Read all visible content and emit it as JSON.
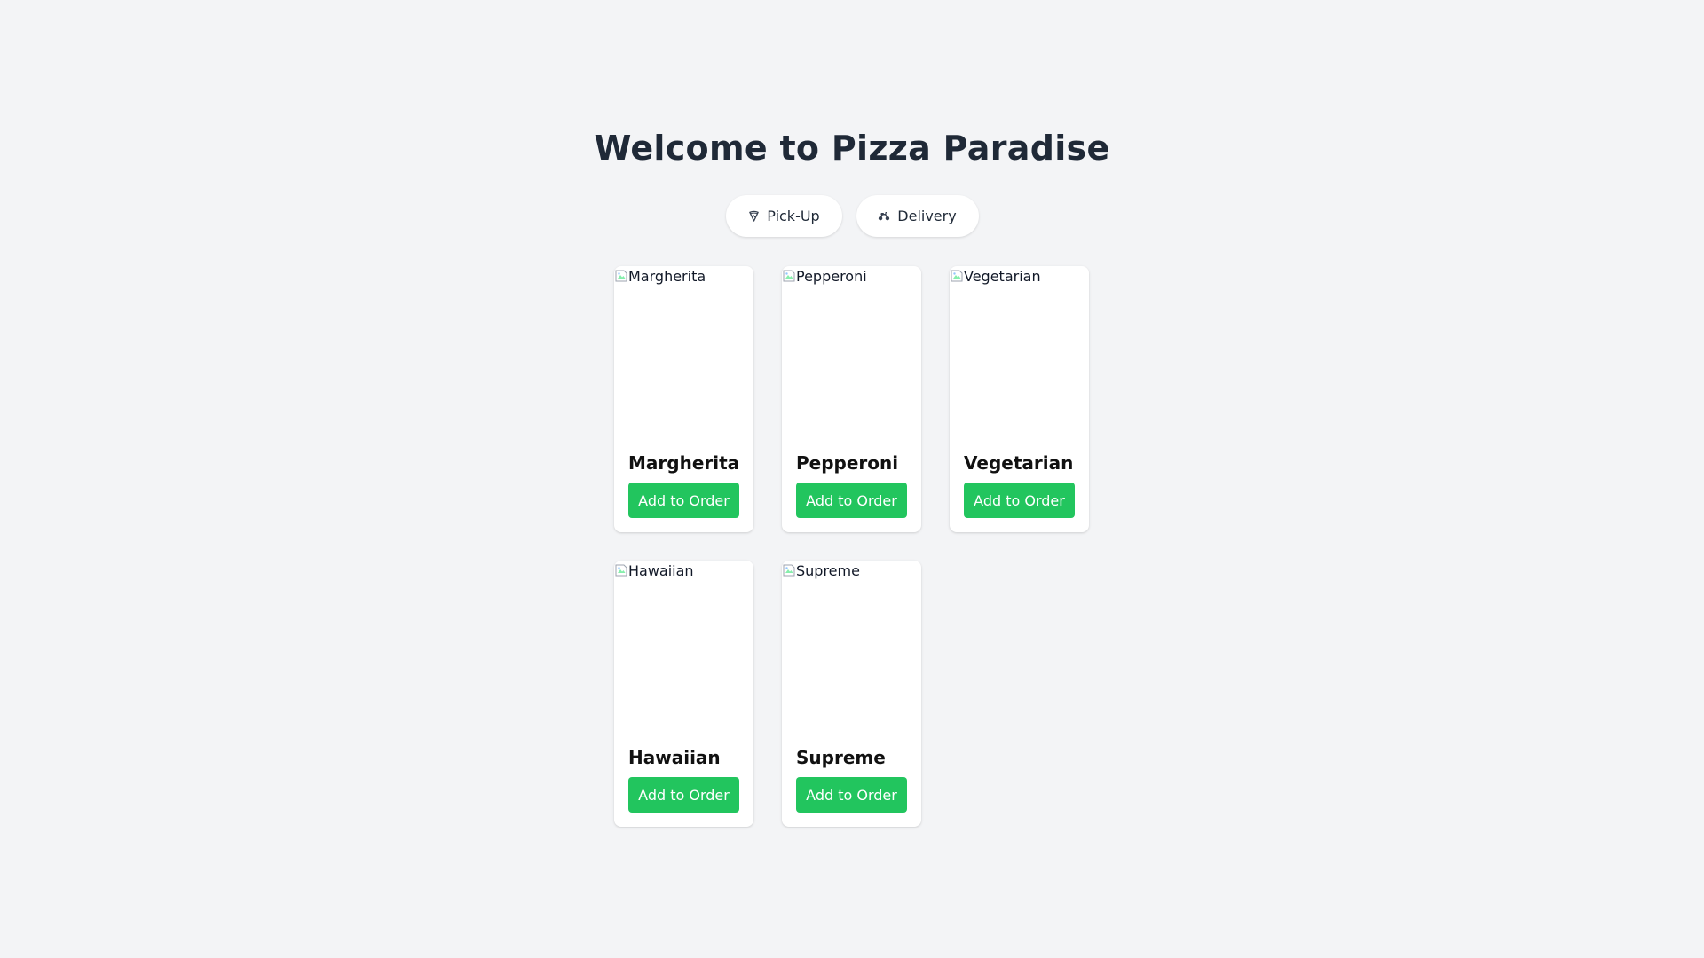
{
  "header": {
    "title": "Welcome to Pizza Paradise"
  },
  "order_modes": [
    {
      "label": "Pick-Up",
      "icon": "pizza-slice-icon"
    },
    {
      "label": "Delivery",
      "icon": "scooter-icon"
    }
  ],
  "menu": {
    "items": [
      {
        "name": "Margherita",
        "image_alt": "Margherita",
        "button_label": "Add to Order"
      },
      {
        "name": "Pepperoni",
        "image_alt": "Pepperoni",
        "button_label": "Add to Order"
      },
      {
        "name": "Vegetarian",
        "image_alt": "Vegetarian",
        "button_label": "Add to Order"
      },
      {
        "name": "Hawaiian",
        "image_alt": "Hawaiian",
        "button_label": "Add to Order"
      },
      {
        "name": "Supreme",
        "image_alt": "Supreme",
        "button_label": "Add to Order"
      }
    ]
  },
  "colors": {
    "background": "#f3f4f6",
    "accent": "#22c55e",
    "title": "#1f2937"
  }
}
